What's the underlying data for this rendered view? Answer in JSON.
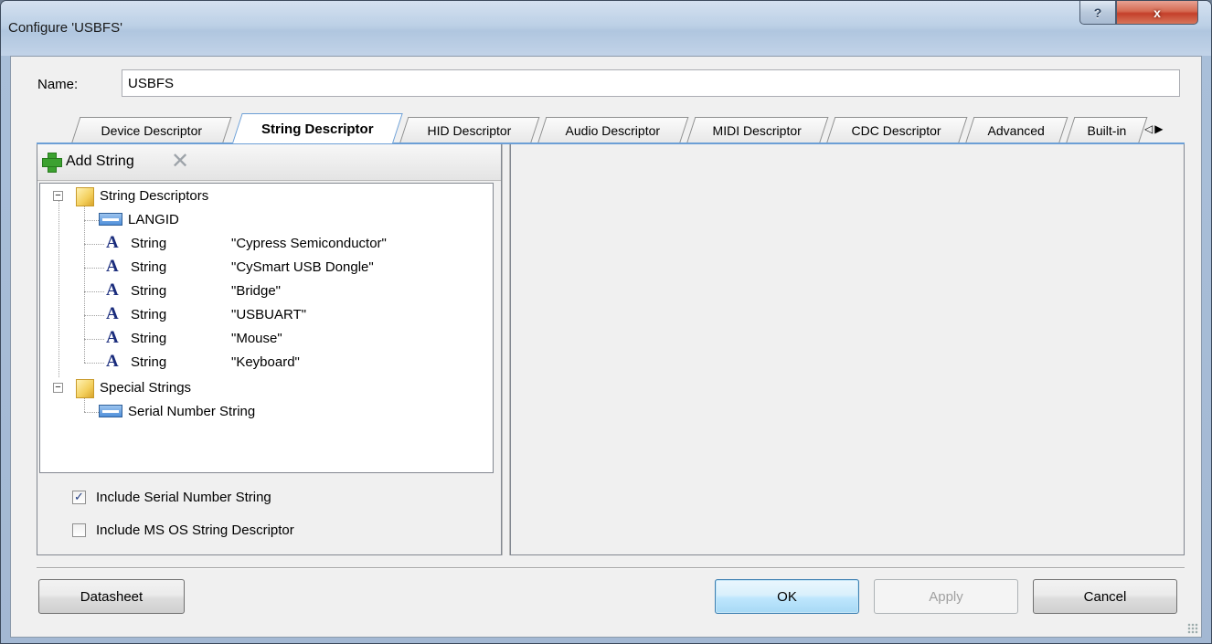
{
  "window": {
    "title": "Configure 'USBFS'",
    "help_label": "?",
    "close_label": "x"
  },
  "name_field": {
    "label": "Name:",
    "value": "USBFS"
  },
  "tabs": [
    {
      "label": "Device Descriptor",
      "active": false
    },
    {
      "label": "String Descriptor",
      "active": true
    },
    {
      "label": "HID Descriptor",
      "active": false
    },
    {
      "label": "Audio Descriptor",
      "active": false
    },
    {
      "label": "MIDI Descriptor",
      "active": false
    },
    {
      "label": "CDC Descriptor",
      "active": false
    },
    {
      "label": "Advanced",
      "active": false
    },
    {
      "label": "Built-in",
      "active": false
    }
  ],
  "toolbar": {
    "add_string_label": "Add String",
    "add_icon": "plus-icon",
    "delete_icon": "delete-x-icon"
  },
  "tree": {
    "groups": [
      {
        "label": "String Descriptors",
        "expanded": true,
        "items": [
          {
            "type": "LANGID",
            "value": "",
            "icon": "langid-icon"
          },
          {
            "type": "String",
            "value": "\"Cypress Semiconductor\"",
            "icon": "string-icon"
          },
          {
            "type": "String",
            "value": "\"CySmart USB Dongle\"",
            "icon": "string-icon"
          },
          {
            "type": "String",
            "value": "\"Bridge\"",
            "icon": "string-icon"
          },
          {
            "type": "String",
            "value": "\"USBUART\"",
            "icon": "string-icon"
          },
          {
            "type": "String",
            "value": "\"Mouse\"",
            "icon": "string-icon"
          },
          {
            "type": "String",
            "value": "\"Keyboard\"",
            "icon": "string-icon"
          }
        ]
      },
      {
        "label": "Special Strings",
        "expanded": true,
        "items": [
          {
            "type": "Serial Number String",
            "value": "",
            "icon": "langid-icon"
          }
        ]
      }
    ]
  },
  "checkboxes": [
    {
      "label": "Include Serial Number String",
      "checked": true
    },
    {
      "label": "Include MS OS String Descriptor",
      "checked": false
    }
  ],
  "buttons": {
    "datasheet": "Datasheet",
    "ok": "OK",
    "apply": "Apply",
    "cancel": "Cancel"
  },
  "colors": {
    "accent_tab_line": "#6c9fd6",
    "string_icon": "#1a2c7c",
    "close_button": "#c4402b"
  }
}
